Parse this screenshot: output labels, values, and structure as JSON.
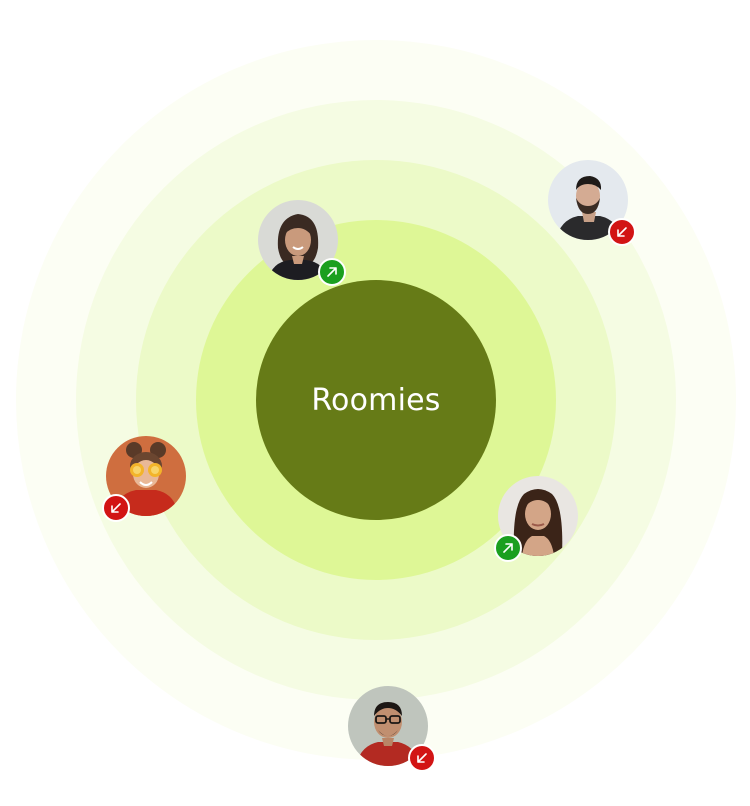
{
  "group": {
    "name": "Roomies"
  },
  "colors": {
    "core": "#667b17",
    "ring_1": "#def796",
    "ring_2": "#ecfac8",
    "ring_3": "#f5fce3",
    "ring_4": "#fcfef4",
    "trend_up": "#1b9f1f",
    "trend_down": "#d21414"
  },
  "members": [
    {
      "id": "member-1",
      "position": "inner-top",
      "trend": "up",
      "badge_icon": "arrow-up-right-icon"
    },
    {
      "id": "member-2",
      "position": "outer-top-right",
      "trend": "down",
      "badge_icon": "arrow-down-left-icon"
    },
    {
      "id": "member-3",
      "position": "outer-left",
      "trend": "down",
      "badge_icon": "arrow-down-left-icon"
    },
    {
      "id": "member-4",
      "position": "middle-right",
      "trend": "up",
      "badge_icon": "arrow-up-right-icon"
    },
    {
      "id": "member-5",
      "position": "outermost-bottom",
      "trend": "down",
      "badge_icon": "arrow-down-left-icon"
    }
  ]
}
